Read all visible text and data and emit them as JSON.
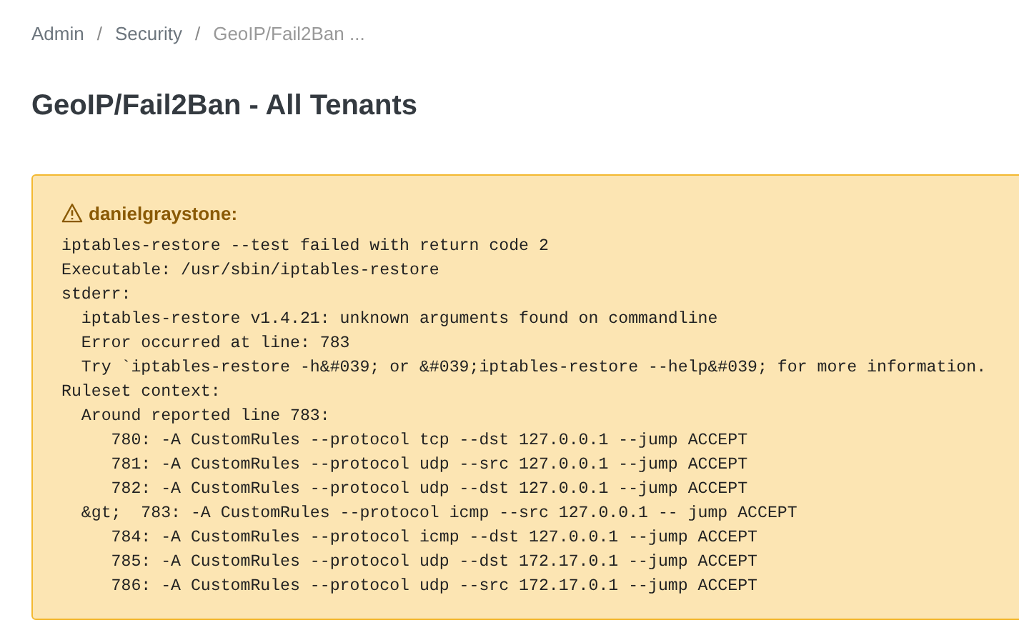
{
  "breadcrumb": [
    {
      "label": "Admin",
      "active": false
    },
    {
      "separator": "/",
      "label": "Security",
      "active": false
    },
    {
      "separator": "/",
      "label": "GeoIP/Fail2Ban ...",
      "active": true
    }
  ],
  "title": "GeoIP/Fail2Ban - All Tenants",
  "alert": {
    "user": "danielgraystone:",
    "lines": [
      "iptables-restore --test failed with return code 2",
      "Executable: /usr/sbin/iptables-restore",
      "stderr:",
      "  iptables-restore v1.4.21: unknown arguments found on commandline",
      "  Error occurred at line: 783",
      "  Try `iptables-restore -h&#039; or &#039;iptables-restore --help&#039; for more information.",
      "Ruleset context:",
      "  Around reported line 783:",
      "     780: -A CustomRules --protocol tcp --dst 127.0.0.1 --jump ACCEPT",
      "     781: -A CustomRules --protocol udp --src 127.0.0.1 --jump ACCEPT",
      "     782: -A CustomRules --protocol udp --dst 127.0.0.1 --jump ACCEPT",
      "  &gt;  783: -A CustomRules --protocol icmp --src 127.0.0.1 -- jump ACCEPT",
      "     784: -A CustomRules --protocol icmp --dst 127.0.0.1 --jump ACCEPT",
      "     785: -A CustomRules --protocol udp --dst 172.17.0.1 --jump ACCEPT",
      "     786: -A CustomRules --protocol udp --src 172.17.0.1 --jump ACCEPT"
    ]
  }
}
